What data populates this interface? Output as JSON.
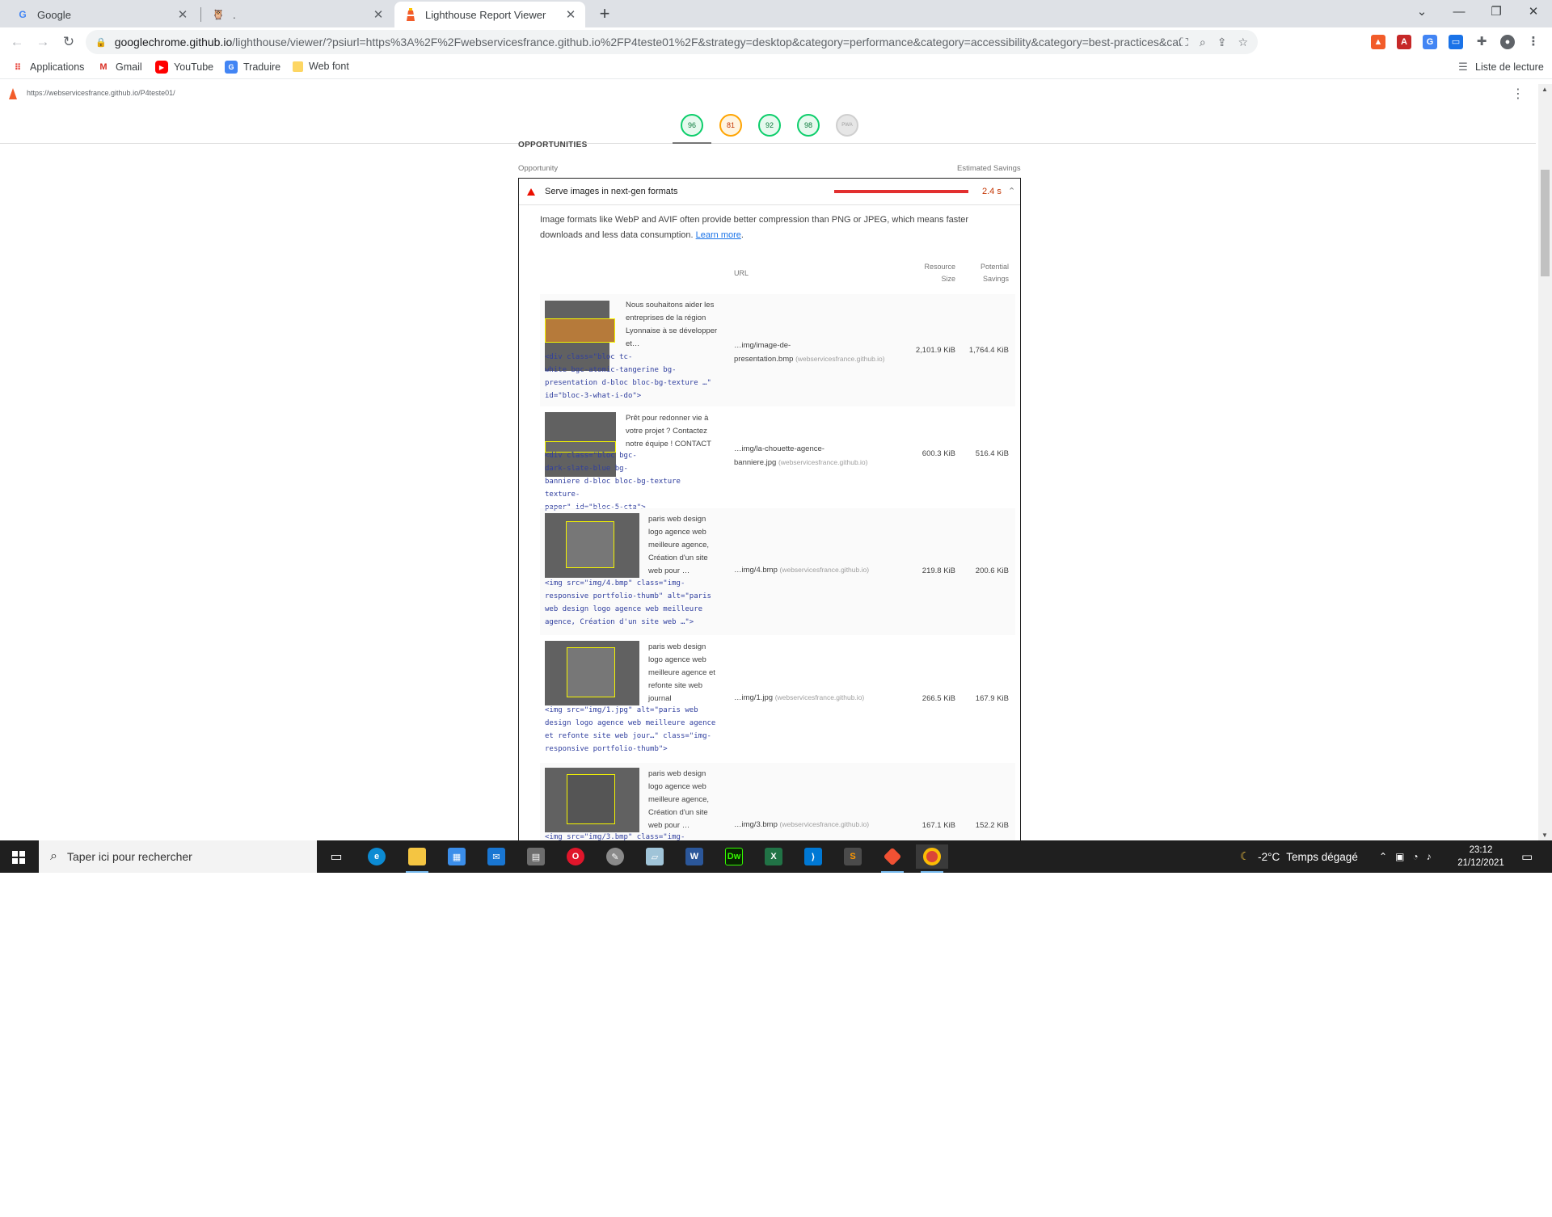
{
  "browser": {
    "tabs": [
      {
        "title": "Google",
        "favicon": "google-g-icon"
      },
      {
        "title": ".",
        "favicon": "webservices-icon"
      },
      {
        "title": "Lighthouse Report Viewer",
        "favicon": "lighthouse-icon",
        "active": true
      }
    ],
    "url_host": "googlechrome.github.io",
    "url_path": "/lighthouse/viewer/?psiurl=https%3A%2F%2Fwebservicesfrance.github.io%2FP4teste01%2F&strategy=desktop&category=performance&category=accessibility&category=best-practices&category=seo...",
    "bookmarks": [
      "Applications",
      "Gmail",
      "YouTube",
      "Traduire",
      "Web font"
    ],
    "reading_list": "Liste de lecture"
  },
  "report": {
    "page_url": "https://webservicesfrance.github.io/P4teste01/",
    "scores": [
      {
        "value": "96",
        "status": "pass"
      },
      {
        "value": "81",
        "status": "average"
      },
      {
        "value": "92",
        "status": "pass"
      },
      {
        "value": "98",
        "status": "pass"
      },
      {
        "value": "PWA",
        "status": "na"
      }
    ],
    "section_title": "OPPORTUNITIES",
    "col_opportunity": "Opportunity",
    "col_savings": "Estimated Savings",
    "audit": {
      "title": "Serve images in next-gen formats",
      "savings": "2.4 s",
      "savings_fraction": 1.0,
      "description": "Image formats like WebP and AVIF often provide better compression than PNG or JPEG, which means faster downloads and less data consumption.",
      "learn_more": "Learn more",
      "table": {
        "h_url": "URL",
        "h_size_1": "Resource",
        "h_size_2": "Size",
        "h_save_1": "Potential",
        "h_save_2": "Savings",
        "rows": [
          {
            "snippet_lines": [
              "Nous souhaitons aider les",
              "entreprises de la région",
              "Lyonnaise à se développer",
              "et…"
            ],
            "node_lines": [
              "<div class=\"bloc tc-",
              "white bgc-atomic-tangerine bg-",
              "presentation d-bloc bloc-bg-texture …\"",
              "id=\"bloc-3-what-i-do\">"
            ],
            "url_lines": [
              "…img/image-de-",
              "presentation.bmp"
            ],
            "domain": "(webservicesfrance.github.io)",
            "size": "2,101.9 KiB",
            "savings": "1,764.4 KiB"
          },
          {
            "snippet_lines": [
              "Prêt pour redonner vie à",
              "votre projet ? Contactez",
              "notre équipe ! CONTACT"
            ],
            "node_lines": [
              "<div class=\"bloc bgc-",
              "dark-slate-blue bg-",
              "banniere d-bloc bloc-bg-texture texture-",
              "paper\" id=\"bloc-5-cta\">"
            ],
            "url_lines": [
              "…img/la-chouette-agence-",
              "banniere.jpg"
            ],
            "domain": "(webservicesfrance.github.io)",
            "size": "600.3 KiB",
            "savings": "516.4 KiB"
          },
          {
            "snippet_lines": [
              "paris web design",
              "logo agence web",
              "meilleure agence,",
              "Création d'un site",
              "web pour …"
            ],
            "node_lines": [
              "<img src=\"img/4.bmp\" class=\"img-",
              "responsive portfolio-thumb\" alt=\"paris",
              "web design logo agence web meilleure",
              "agence, Création d'un site web …\">"
            ],
            "url_lines": [
              "…img/4.bmp"
            ],
            "domain": "(webservicesfrance.github.io)",
            "size": "219.8 KiB",
            "savings": "200.6 KiB"
          },
          {
            "snippet_lines": [
              "paris web design",
              "logo agence web",
              "meilleure agence et",
              "refonte site web",
              "journal"
            ],
            "node_lines": [
              "<img src=\"img/1.jpg\" alt=\"paris web",
              "design logo agence web meilleure agence",
              "et refonte site web jour…\" class=\"img-",
              "responsive portfolio-thumb\">"
            ],
            "url_lines": [
              "…img/1.jpg"
            ],
            "domain": "(webservicesfrance.github.io)",
            "size": "266.5 KiB",
            "savings": "167.9 KiB"
          },
          {
            "snippet_lines": [
              "paris web design",
              "logo agence web",
              "meilleure agence,",
              "Création d'un site",
              "web pour …"
            ],
            "node_lines": [
              "<img src=\"img/3.bmp\" class=\"img-"
            ],
            "url_lines": [
              "…img/3.bmp"
            ],
            "domain": "(webservicesfrance.github.io)",
            "size": "167.1 KiB",
            "savings": "152.2 KiB"
          }
        ]
      }
    }
  },
  "taskbar": {
    "search_placeholder": "Taper ici pour rechercher",
    "weather_temp": "-2°C",
    "weather_text": "Temps dégagé",
    "time": "23:12",
    "date": "21/12/2021"
  },
  "colors": {
    "pass": "#0cce6b",
    "average": "#ffa400",
    "fail": "#eb0f00",
    "link": "#1a73e8",
    "node": "#303f9f"
  }
}
